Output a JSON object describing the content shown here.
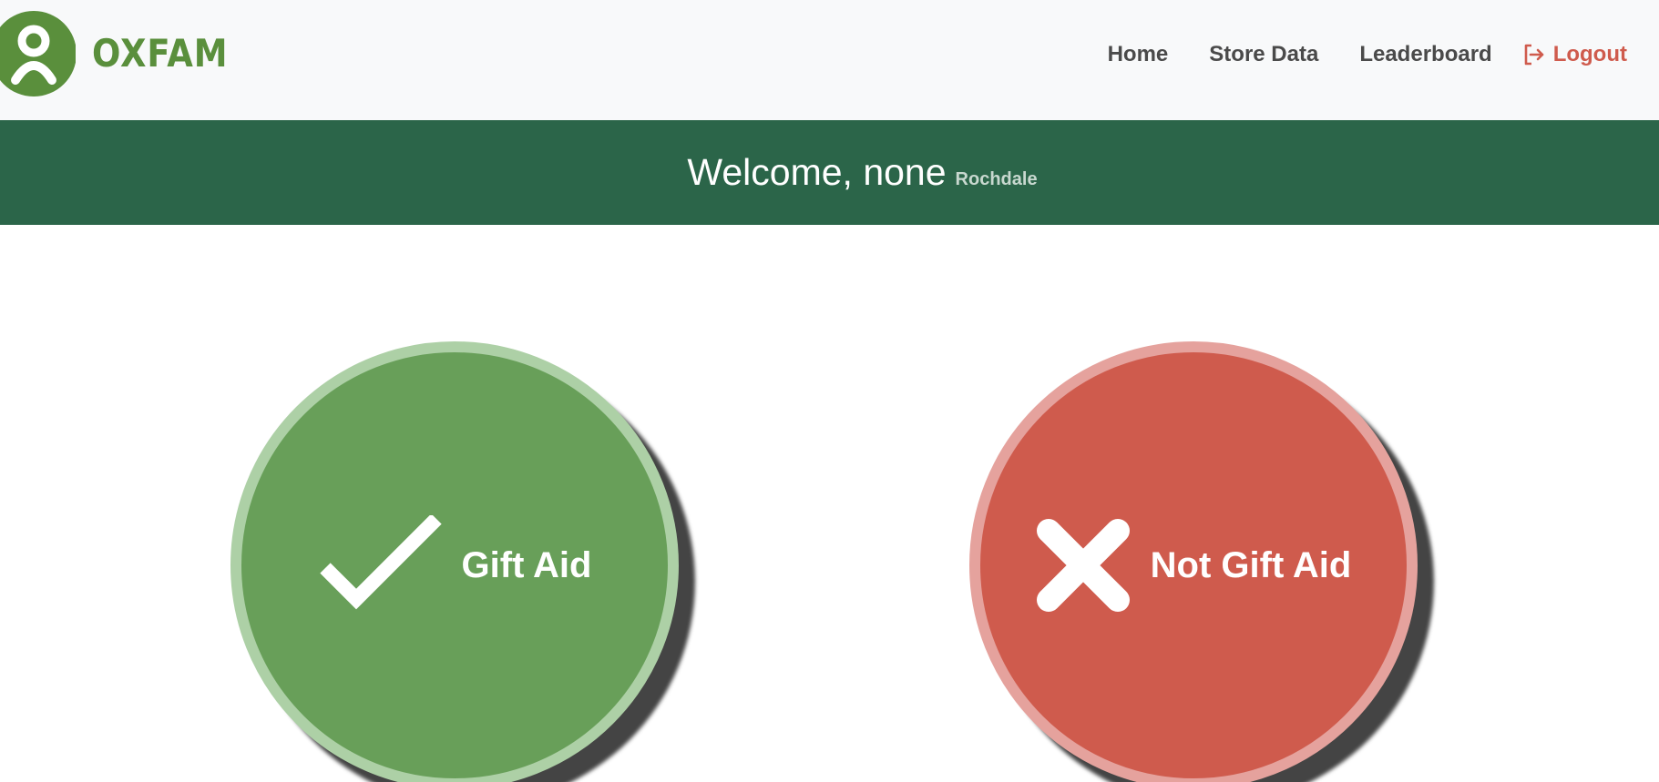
{
  "brand": {
    "name": "OXFAM",
    "icon": "oxfam-logo-icon",
    "color": "#5a8f3c"
  },
  "nav": {
    "items": [
      {
        "label": "Home"
      },
      {
        "label": "Store Data"
      },
      {
        "label": "Leaderboard"
      }
    ],
    "logout_label": "Logout",
    "logout_icon": "sign-out-icon",
    "logout_color": "#cf5b4d"
  },
  "banner": {
    "welcome": "Welcome, none",
    "location": "Rochdale",
    "background": "#2b6549"
  },
  "actions": {
    "gift_aid_label": "Gift Aid",
    "gift_aid_icon": "checkmark-icon",
    "gift_aid_color": "#689f59",
    "not_gift_aid_label": "Not Gift Aid",
    "not_gift_aid_icon": "cross-icon",
    "not_gift_aid_color": "#cf5b4d"
  }
}
